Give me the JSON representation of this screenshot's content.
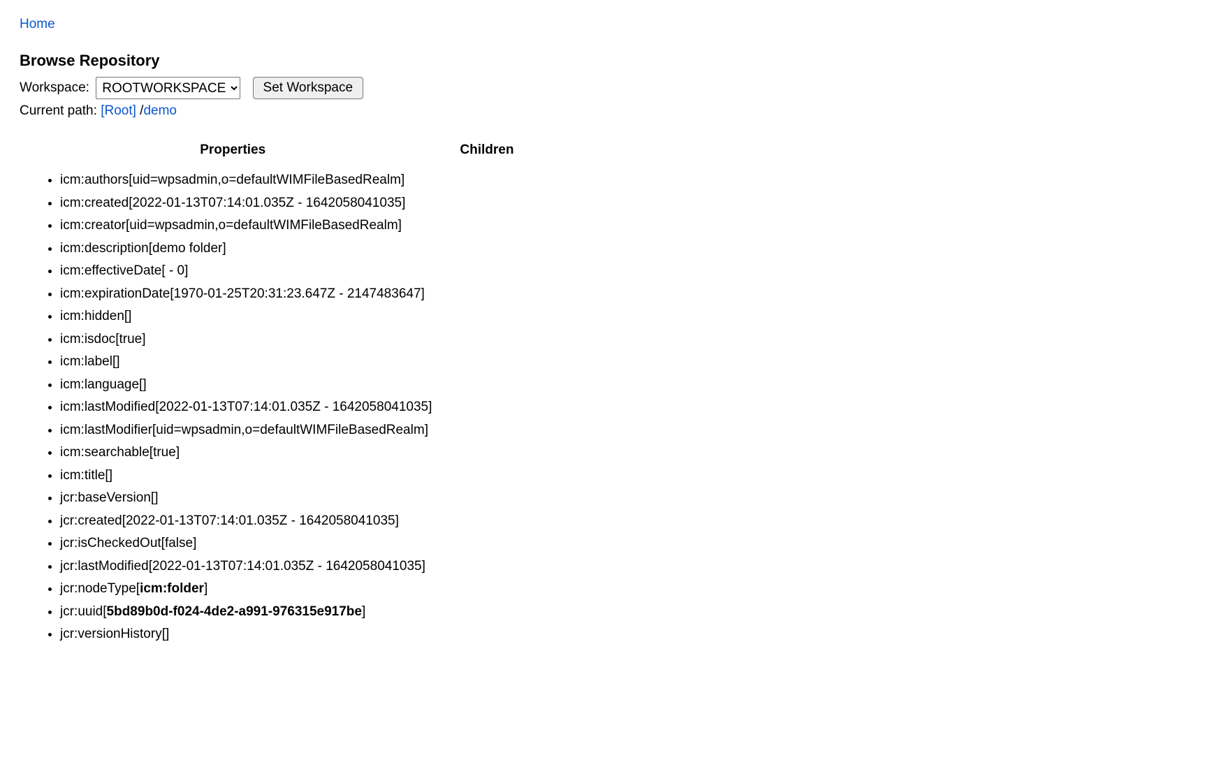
{
  "nav": {
    "home_label": "Home"
  },
  "header": {
    "title": "Browse Repository",
    "workspace_label": "Workspace:",
    "workspace_selected": "ROOTWORKSPACE",
    "set_workspace_label": "Set Workspace",
    "current_path_label": "Current path:",
    "path_root_label": "[Root]",
    "path_sep": " /",
    "path_node_label": "demo"
  },
  "columns": {
    "properties_heading": "Properties",
    "children_heading": "Children"
  },
  "properties": [
    {
      "name": "icm:authors",
      "value": "uid=wpsadmin,o=defaultWIMFileBasedRealm",
      "bold": false
    },
    {
      "name": "icm:created",
      "value": "2022-01-13T07:14:01.035Z - 1642058041035",
      "bold": false
    },
    {
      "name": "icm:creator",
      "value": "uid=wpsadmin,o=defaultWIMFileBasedRealm",
      "bold": false
    },
    {
      "name": "icm:description",
      "value": "demo folder",
      "bold": false
    },
    {
      "name": "icm:effectiveDate",
      "value": " - 0",
      "bold": false
    },
    {
      "name": "icm:expirationDate",
      "value": "1970-01-25T20:31:23.647Z - 2147483647",
      "bold": false
    },
    {
      "name": "icm:hidden",
      "value": "",
      "bold": false
    },
    {
      "name": "icm:isdoc",
      "value": "true",
      "bold": false
    },
    {
      "name": "icm:label",
      "value": "",
      "bold": false
    },
    {
      "name": "icm:language",
      "value": "",
      "bold": false
    },
    {
      "name": "icm:lastModified",
      "value": "2022-01-13T07:14:01.035Z - 1642058041035",
      "bold": false
    },
    {
      "name": "icm:lastModifier",
      "value": "uid=wpsadmin,o=defaultWIMFileBasedRealm",
      "bold": false
    },
    {
      "name": "icm:searchable",
      "value": "true",
      "bold": false
    },
    {
      "name": "icm:title",
      "value": "",
      "bold": false
    },
    {
      "name": "jcr:baseVersion",
      "value": "",
      "bold": false
    },
    {
      "name": "jcr:created",
      "value": "2022-01-13T07:14:01.035Z - 1642058041035",
      "bold": false
    },
    {
      "name": "jcr:isCheckedOut",
      "value": "false",
      "bold": false
    },
    {
      "name": "jcr:lastModified",
      "value": "2022-01-13T07:14:01.035Z - 1642058041035",
      "bold": false
    },
    {
      "name": "jcr:nodeType",
      "value": "icm:folder",
      "bold": true
    },
    {
      "name": "jcr:uuid",
      "value": "5bd89b0d-f024-4de2-a991-976315e917be",
      "bold": true
    },
    {
      "name": "jcr:versionHistory",
      "value": "",
      "bold": false
    }
  ],
  "children": []
}
